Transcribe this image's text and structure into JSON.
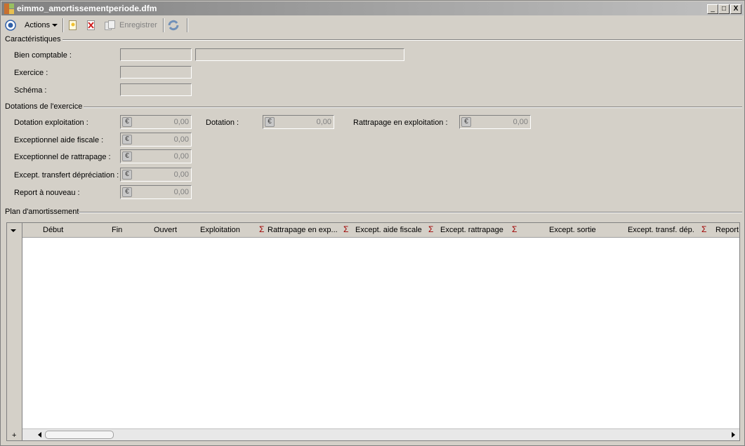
{
  "window": {
    "title": "eimmo_amortissementperiode.dfm",
    "buttons": [
      "_",
      "□",
      "X"
    ]
  },
  "toolbar": {
    "actions_label": "Actions",
    "save_label": "Enregistrer",
    "icons": [
      "radio-target-icon",
      "new-document-icon",
      "delete-icon",
      "save-icon",
      "refresh-icon"
    ]
  },
  "caracteristiques": {
    "title": "Caractéristiques",
    "bien_label": "Bien comptable :",
    "bien_code": "",
    "bien_desc": "",
    "exercice_label": "Exercice :",
    "exercice_value": "",
    "schema_label": "Schéma :",
    "schema_value": ""
  },
  "dotations": {
    "title": "Dotations de l'exercice",
    "fields": [
      {
        "label": "Dotation exploitation :",
        "value": "0,00"
      },
      {
        "label": "Exceptionnel aide fiscale :",
        "value": "0,00"
      },
      {
        "label": "Exceptionnel de rattrapage :",
        "value": "0,00"
      },
      {
        "label": "Except. transfert dépréciation :",
        "value": "0,00"
      },
      {
        "label": "Report à nouveau :",
        "value": "0,00"
      }
    ],
    "dotation_label": "Dotation :",
    "dotation_value": "0,00",
    "rattrapage_label": "Rattrapage en exploitation :",
    "rattrapage_value": "0,00",
    "currency_symbol": "€"
  },
  "plan": {
    "title": "Plan d'amortissement",
    "columns": [
      "Début",
      "Fin",
      "Ouvert",
      "Exploitation",
      "Rattrapage en exp...",
      "Except. aide fiscale",
      "Except. rattrapage",
      "Except. sortie",
      "Except. transf. dép.",
      "Report"
    ],
    "sigma": "Σ",
    "add_symbol": "+"
  }
}
